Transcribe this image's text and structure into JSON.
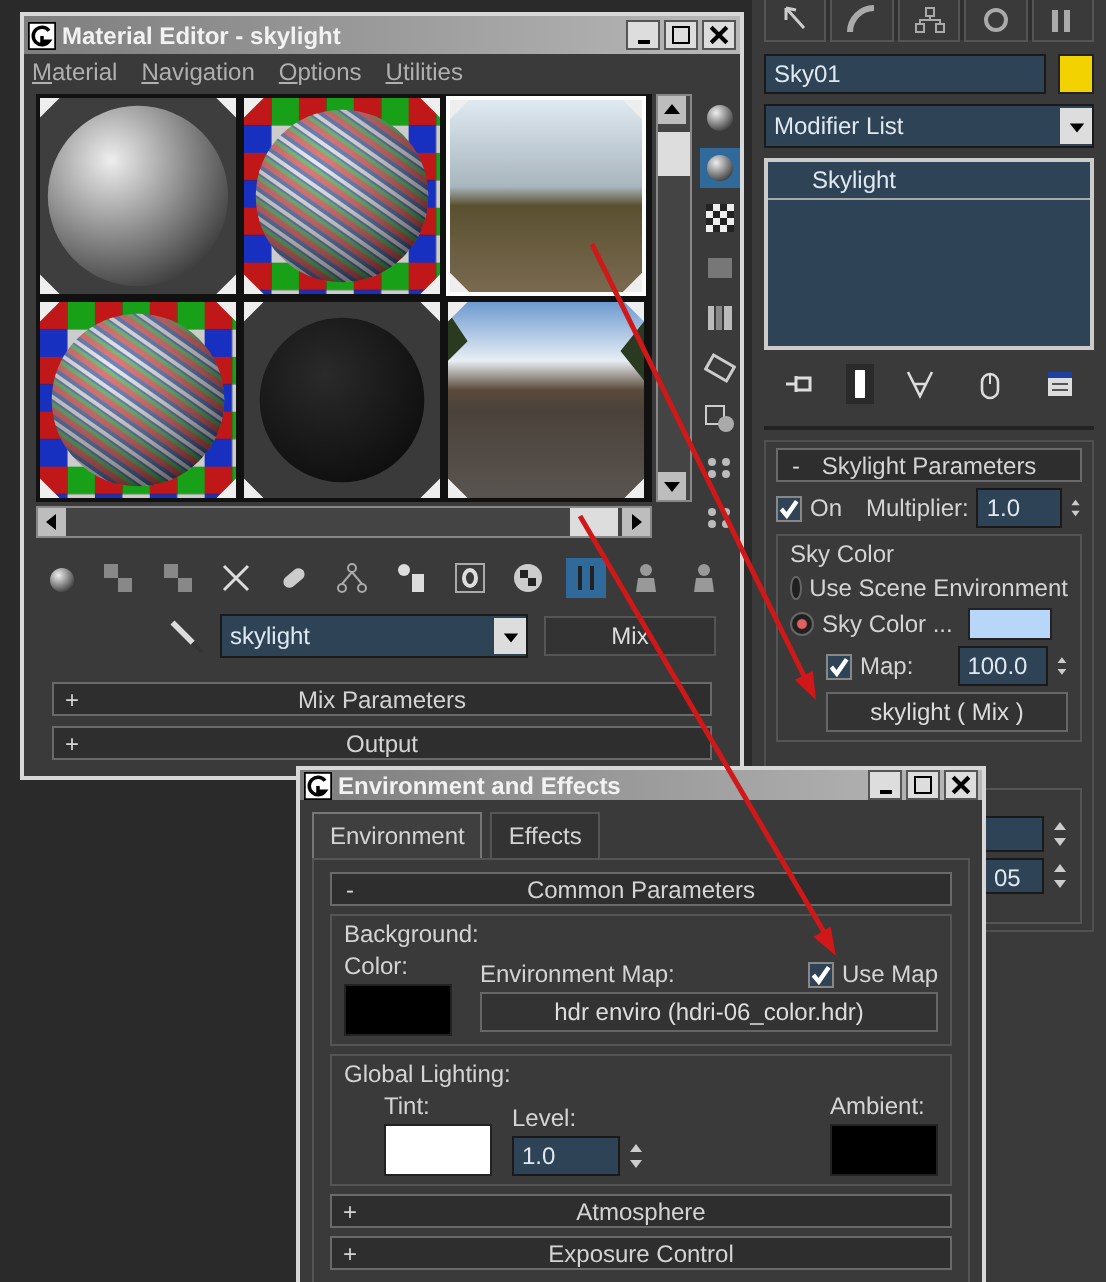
{
  "material_editor": {
    "title": "Material Editor - skylight",
    "menu": [
      "Material",
      "Navigation",
      "Options",
      "Utilities"
    ],
    "slots": [
      {
        "kind": "gray-sphere",
        "selected": false
      },
      {
        "kind": "checker-sphere",
        "selected": false
      },
      {
        "kind": "blurry-photo",
        "selected": true
      },
      {
        "kind": "checker-sphere",
        "selected": false
      },
      {
        "kind": "dark-sphere",
        "selected": false
      },
      {
        "kind": "photo",
        "selected": false
      }
    ],
    "side_tools": [
      {
        "on": false
      },
      {
        "on": true
      },
      {
        "on": false
      },
      {
        "on": false
      },
      {
        "on": false
      },
      {
        "on": false
      },
      {
        "on": false
      },
      {
        "on": false
      },
      {
        "on": false
      }
    ],
    "tools": [
      {
        "on": false
      },
      {
        "on": false
      },
      {
        "on": false
      },
      {
        "on": false
      },
      {
        "on": false
      },
      {
        "on": false
      },
      {
        "on": false
      },
      {
        "on": false
      },
      {
        "on": false
      },
      {
        "on": true
      },
      {
        "on": false
      },
      {
        "on": false
      }
    ],
    "material_name": "skylight",
    "material_type": "Mix",
    "rollouts": [
      {
        "sign": "+",
        "label": "Mix Parameters"
      },
      {
        "sign": "+",
        "label": "Output"
      }
    ]
  },
  "command_panel": {
    "tabs": [
      {
        "selected": false
      },
      {
        "selected": false
      },
      {
        "selected": false
      },
      {
        "selected": false
      },
      {
        "selected": false
      }
    ],
    "object_name": "Sky01",
    "modifier_list": "Modifier List",
    "stack": [
      {
        "label": "Skylight",
        "selected": false
      }
    ],
    "stack_tools": [
      {
        "on": false
      },
      {
        "on": true
      },
      {
        "on": false
      },
      {
        "on": false
      },
      {
        "on": false
      }
    ],
    "rollout": {
      "sign": "-",
      "label": "Skylight Parameters"
    },
    "on": {
      "label": "On",
      "checked": true
    },
    "multiplier": {
      "label": "Multiplier:",
      "value": "1.0"
    },
    "sky_group": "Sky Color",
    "radios": [
      {
        "label": "Use Scene Environment",
        "selected": false
      },
      {
        "label": "Sky Color ...",
        "selected": true
      }
    ],
    "map": {
      "label": "Map:",
      "checked": true,
      "value": "100.0"
    },
    "map_button": "skylight ( Mix )",
    "lower_spinner_value": "05"
  },
  "environment": {
    "title": "Environment and Effects",
    "tabs": [
      {
        "label": "Environment",
        "selected": true
      },
      {
        "label": "Effects",
        "selected": false
      }
    ],
    "rollout": {
      "sign": "-",
      "label": "Common Parameters"
    },
    "background": {
      "group": "Background:",
      "color_label": "Color:",
      "env_map_label": "Environment Map:",
      "use_map": {
        "label": "Use Map",
        "checked": true
      },
      "map_button": "hdr enviro (hdri-06_color.hdr)"
    },
    "global_lighting": {
      "group": "Global Lighting:",
      "tint_label": "Tint:",
      "level_label": "Level:",
      "level_value": "1.0",
      "ambient_label": "Ambient:"
    },
    "more_rollouts": [
      {
        "sign": "+",
        "label": "Atmosphere"
      },
      {
        "sign": "+",
        "label": "Exposure Control"
      }
    ]
  }
}
